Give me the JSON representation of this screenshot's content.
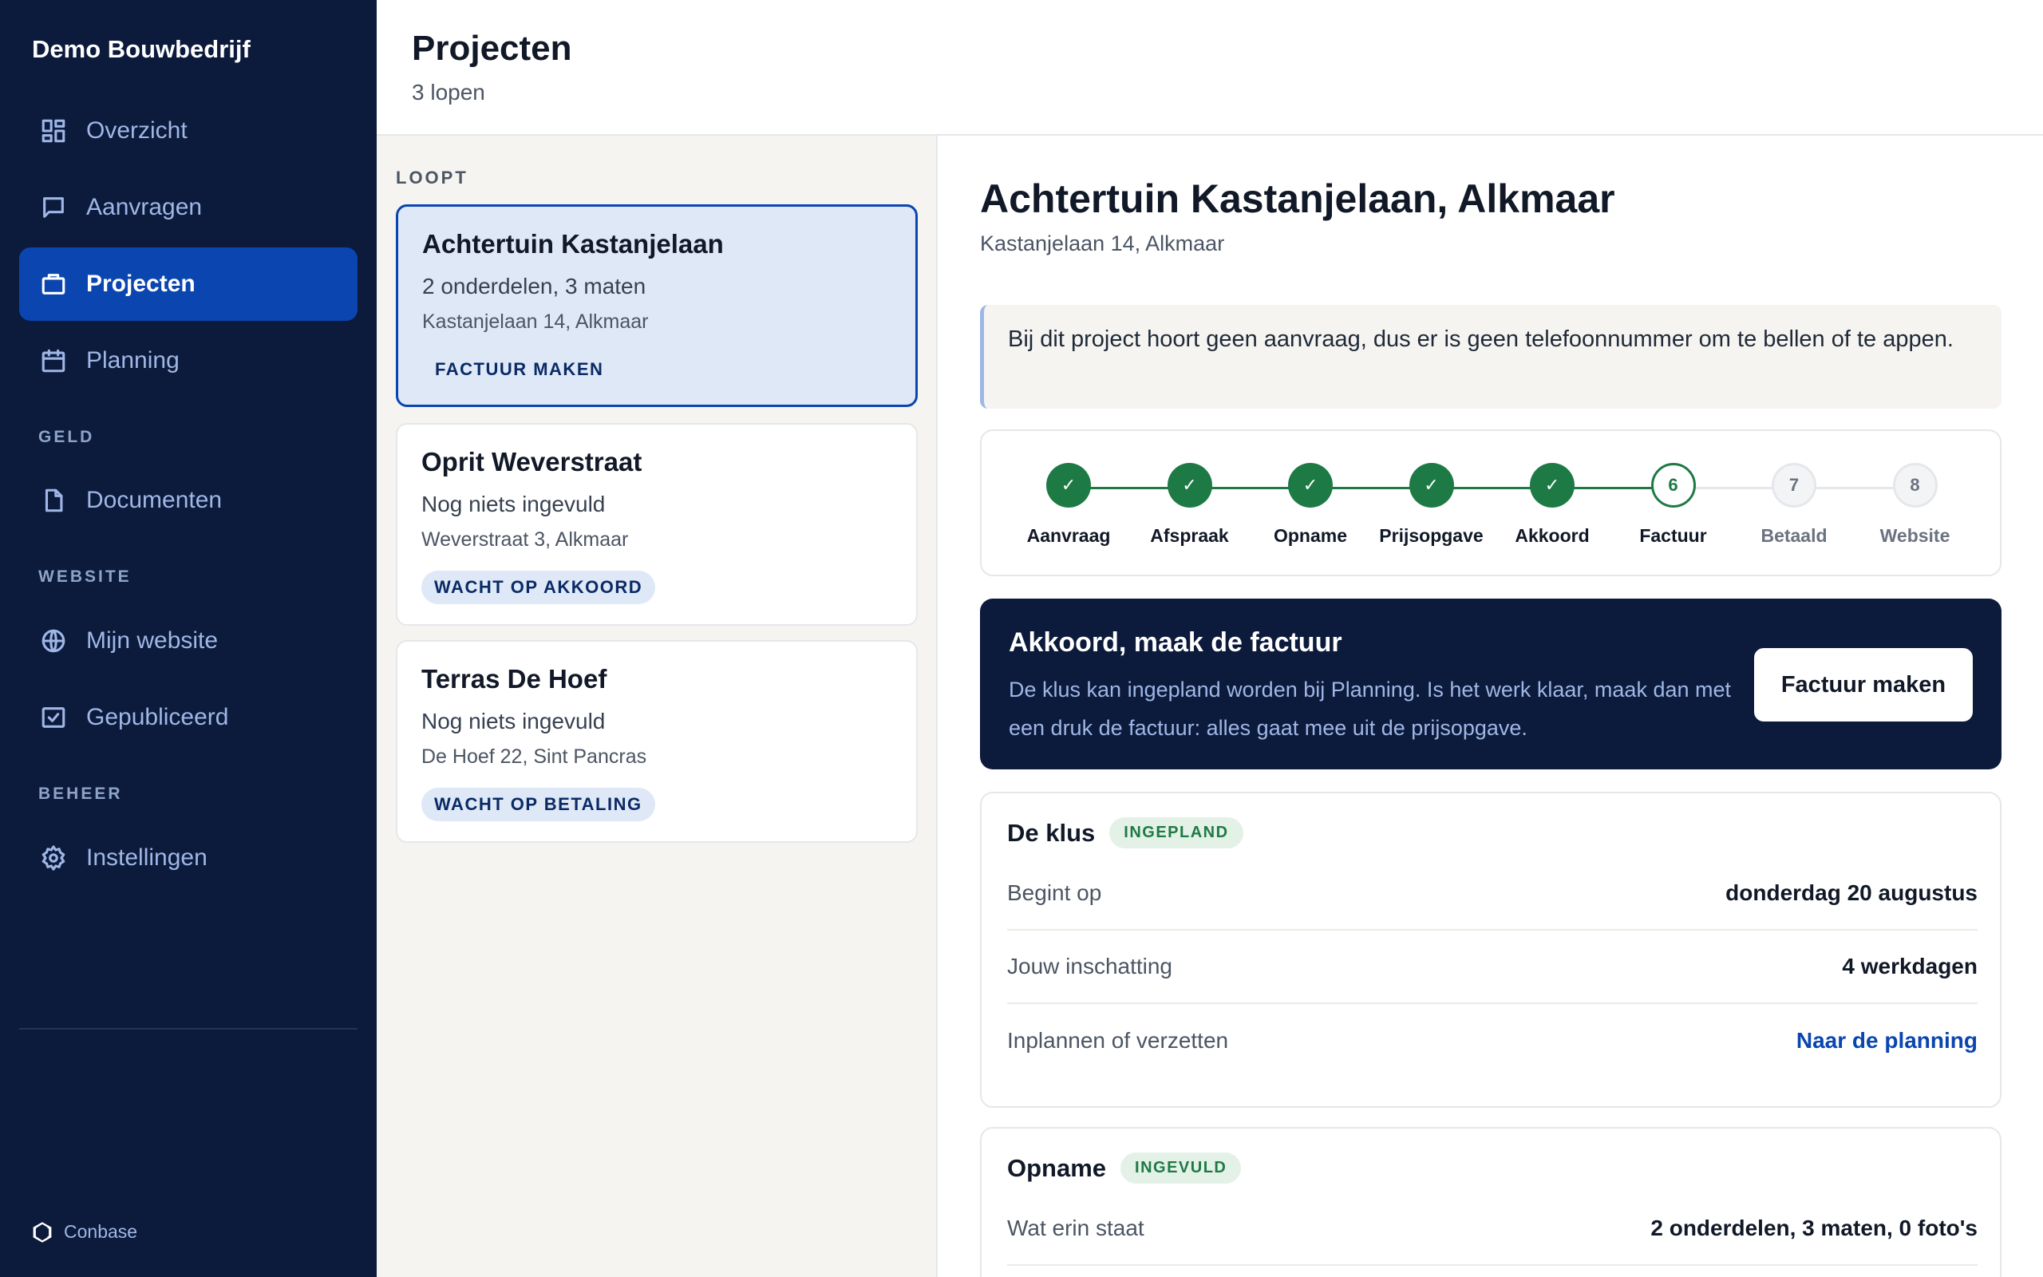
{
  "sidebar": {
    "brand": "Demo Bouwbedrijf",
    "items": {
      "overzicht": "Overzicht",
      "aanvragen": "Aanvragen",
      "projecten": "Projecten",
      "planning": "Planning",
      "documenten": "Documenten",
      "mijn_website": "Mijn website",
      "gepubliceerd": "Gepubliceerd",
      "instellingen": "Instellingen"
    },
    "sections": {
      "geld": "GELD",
      "website": "WEBSITE",
      "beheer": "BEHEER"
    },
    "footer": "Conbase"
  },
  "header": {
    "title": "Projecten",
    "subtitle": "3 lopen"
  },
  "list": {
    "heading": "LOOPT",
    "projects": [
      {
        "title": "Achtertuin Kastanjelaan",
        "summary": "2 onderdelen, 3 maten",
        "address": "Kastanjelaan 14, Alkmaar",
        "badge": "FACTUUR MAKEN"
      },
      {
        "title": "Oprit Weverstraat",
        "summary": "Nog niets ingevuld",
        "address": "Weverstraat 3, Alkmaar",
        "badge": "WACHT OP AKKOORD"
      },
      {
        "title": "Terras De Hoef",
        "summary": "Nog niets ingevuld",
        "address": "De Hoef 22, Sint Pancras",
        "badge": "WACHT OP BETALING"
      }
    ]
  },
  "detail": {
    "title": "Achtertuin Kastanjelaan, Alkmaar",
    "address": "Kastanjelaan 14, Alkmaar",
    "notice": "Bij dit project hoort geen aanvraag, dus er is geen telefoonnummer om te bellen of te appen.",
    "steps": [
      {
        "number": "1",
        "label": "Aanvraag",
        "state": "done"
      },
      {
        "number": "2",
        "label": "Afspraak",
        "state": "done"
      },
      {
        "number": "3",
        "label": "Opname",
        "state": "done"
      },
      {
        "number": "4",
        "label": "Prijsopgave",
        "state": "done"
      },
      {
        "number": "5",
        "label": "Akkoord",
        "state": "done"
      },
      {
        "number": "6",
        "label": "Factuur",
        "state": "current"
      },
      {
        "number": "7",
        "label": "Betaald",
        "state": "todo"
      },
      {
        "number": "8",
        "label": "Website",
        "state": "todo"
      }
    ],
    "checkmark": "✓",
    "cta": {
      "title": "Akkoord, maak de factuur",
      "text": "De klus kan ingepland worden bij Planning. Is het werk klaar, maak dan met een druk de factuur: alles gaat mee uit de prijsopgave.",
      "button": "Factuur maken"
    },
    "klus": {
      "title": "De klus",
      "badge": "INGEPLAND",
      "rows": [
        {
          "key": "Begint op",
          "value": "donderdag 20 augustus"
        },
        {
          "key": "Jouw inschatting",
          "value": "4 werkdagen"
        },
        {
          "key": "Inplannen of verzetten",
          "value": "Naar de planning"
        }
      ]
    },
    "opname": {
      "title": "Opname",
      "badge": "INGEVULD",
      "rows": [
        {
          "key": "Wat erin staat",
          "value": "2 onderdelen, 3 maten, 0 foto's"
        }
      ]
    }
  },
  "colors": {
    "sidebar_bg": "#0c1a3b",
    "accent": "#0a45b0",
    "success": "#1e7a45",
    "list_bg": "#f5f4f1"
  }
}
